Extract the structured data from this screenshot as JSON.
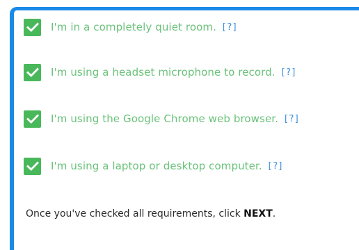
{
  "requirements": [
    {
      "label": "I'm in a completely quiet room.",
      "help": "[?]",
      "checked": true
    },
    {
      "label": "I'm using a headset microphone to record.",
      "help": "[?]",
      "checked": true
    },
    {
      "label": "I'm using the Google Chrome web browser.",
      "help": "[?]",
      "checked": true
    },
    {
      "label": "I'm using a laptop or desktop computer.",
      "help": "[?]",
      "checked": true
    }
  ],
  "footer": {
    "text_before": "Once you've checked all requirements, click ",
    "emphasis": "NEXT",
    "text_after": "."
  },
  "colors": {
    "accent_border": "#1a8ae8",
    "checkbox_fill": "#49b85b",
    "label_text": "#6ac27a",
    "help_link": "#3d8ede"
  }
}
